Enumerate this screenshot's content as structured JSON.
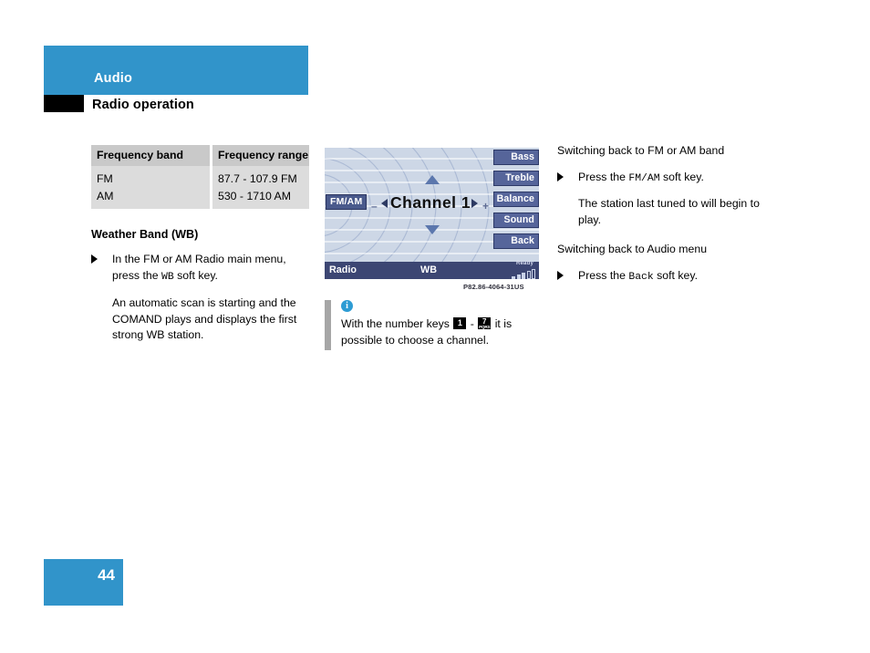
{
  "header": {
    "chapter": "Audio",
    "section": "Radio operation"
  },
  "footer": {
    "page_number": "44"
  },
  "colors": {
    "brand_blue": "#3194ca",
    "display_bg": "#cdd7e6",
    "softkey": "#56659a",
    "statusbar": "#3c4673",
    "table_header": "#c9c9c9",
    "table_body": "#dcdcdc",
    "info_icon": "#2d9cd4",
    "note_bar": "#a6a6a6"
  },
  "column1": {
    "table": {
      "headers": [
        "Frequency band",
        "Frequency range"
      ],
      "rows": [
        [
          "FM",
          "87.7 - 107.9 FM"
        ],
        [
          "AM",
          "530 - 1710 AM"
        ]
      ]
    },
    "subheading": "Weather Band (WB)",
    "bullet": {
      "text_before": "In the FM or AM Radio main menu, press the ",
      "softkey": "WB",
      "text_after": " soft key."
    },
    "paragraph": "An automatic scan is starting and the COMAND plays and displays the first strong WB station."
  },
  "display": {
    "fm_am_button": "FM/AM",
    "minus": "–",
    "plus": "+",
    "channel_label": "Channel 1",
    "arrow_up": "up-arrow",
    "arrow_down": "down-arrow",
    "softkeys": [
      "Bass",
      "Treble",
      "Balance",
      "Sound",
      "Back"
    ],
    "status": {
      "left": "Radio",
      "middle": "WB",
      "ready": "Ready",
      "signal_bars_filled": 3,
      "signal_bars_total": 5
    },
    "image_code": "P82.86-4064-31US"
  },
  "note": {
    "icon": "i",
    "text_before": "With the number keys ",
    "key_from": {
      "number": "1",
      "letters": ""
    },
    "separator": " - ",
    "key_to": {
      "number": "7",
      "letters": "PQRS"
    },
    "text_after": " it is possible to choose a channel."
  },
  "column3": {
    "heading1": "Switching back to FM or AM band",
    "bullet1": {
      "text_before": "Press the ",
      "softkey": "FM/AM",
      "text_after": " soft key."
    },
    "paragraph1": "The station last tuned to will begin to play.",
    "heading2": "Switching back to Audio menu",
    "bullet2": {
      "text_before": "Press the ",
      "softkey": "Back",
      "text_after": " soft key."
    }
  }
}
